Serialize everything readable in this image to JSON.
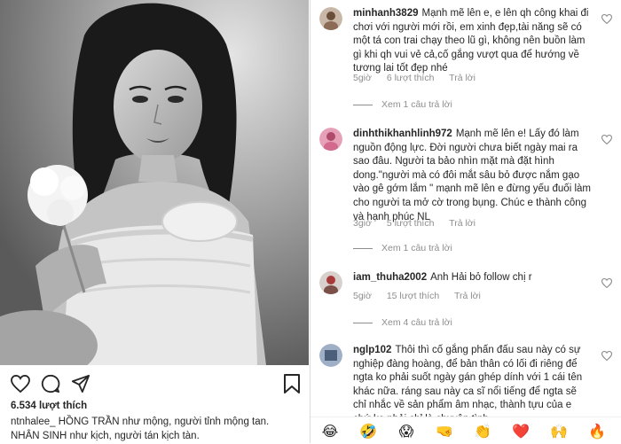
{
  "post": {
    "likes_text": "6.534 lượt thích",
    "caption_user": "ntnhalee_",
    "caption_text": "HỒNG TRẦN như mộng, người tỉnh mộng tan.",
    "caption_text_2": "NHÂN SINH như kịch, người tán kịch tàn."
  },
  "comments": [
    {
      "username": "minhanh3829",
      "text": "Mạnh mẽ lên e, e lên qh công khai đi chơi với người mới rồi, em xinh đẹp,tài năng sẽ có một tá con trai chạy theo lũ gì, không nên buồn làm gì khi qh vui vẻ cả,cố gắng vượt qua để hướng về tương lai tốt đẹp nhé",
      "time": "5giờ",
      "likes": "6 lượt thích",
      "reply_label": "Trả lời",
      "view_replies": "Xem 1 câu trả lời"
    },
    {
      "username": "dinhthikhanhlinh972",
      "text": "Mạnh mẽ lên e! Lấy đó làm nguồn động lực. Đời người chưa biết ngày mai ra sao đâu. Người ta bảo nhìn mặt mà đặt hình dong.\"người mà có đôi mắt sâu bỏ được nắm gạo vào gê gớm lắm \" mạnh mẽ lên e đừng yếu đuối làm cho người ta mở cờ trong bụng. Chúc e thành công và hạnh phúc NL",
      "time": "3giờ",
      "likes": "5 lượt thích",
      "reply_label": "Trả lời",
      "view_replies": "Xem 1 câu trả lời"
    },
    {
      "username": "iam_thuha2002",
      "text": "Anh Hải bỏ follow chị r",
      "time": "5giờ",
      "likes": "15 lượt thích",
      "reply_label": "Trả lời",
      "view_replies": "Xem 4 câu trả lời"
    },
    {
      "username": "nglp102",
      "text": "Thôi thì cố gắng phấn đấu sau này có sự nghiệp đàng hoàng, để bản thân có lối đi riêng để ngta ko phải suốt ngày gán ghép dính với 1 cái tên khác nữa. ráng sau này ca sĩ nổi tiếng để ngta sẽ chỉ nhắc về sản phẩm âm nhạc, thành tựu của e chứ ko phải chỉ là chuyện tình"
    }
  ],
  "emoji_bar": [
    "😂",
    "🤣",
    "😱",
    "🤜",
    "👏",
    "❤️",
    "🙌",
    "🔥"
  ],
  "colors": {
    "text": "#262626",
    "meta": "#8e8e8e",
    "divider": "#dbdbdb"
  },
  "icons": [
    "heart-icon",
    "comment-icon",
    "share-icon",
    "bookmark-icon"
  ]
}
